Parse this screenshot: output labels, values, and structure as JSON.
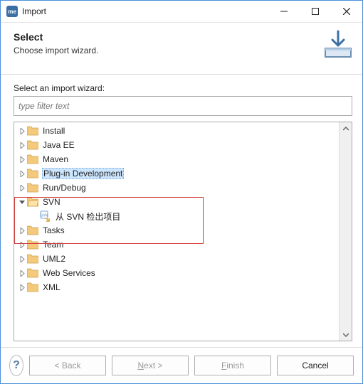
{
  "titlebar": {
    "app_short": "me",
    "title": "Import"
  },
  "header": {
    "heading": "Select",
    "subtext": "Choose import wizard."
  },
  "body": {
    "select_label": "Select an import wizard:",
    "filter_placeholder": "type filter text"
  },
  "tree": {
    "nodes": [
      {
        "label": "Install",
        "depth": 0,
        "expanded": false,
        "icon": "folder",
        "selected": false
      },
      {
        "label": "Java EE",
        "depth": 0,
        "expanded": false,
        "icon": "folder",
        "selected": false
      },
      {
        "label": "Maven",
        "depth": 0,
        "expanded": false,
        "icon": "folder",
        "selected": false
      },
      {
        "label": "Plug-in Development",
        "depth": 0,
        "expanded": false,
        "icon": "folder",
        "selected": false,
        "highlight": true
      },
      {
        "label": "Run/Debug",
        "depth": 0,
        "expanded": false,
        "icon": "folder",
        "selected": false
      },
      {
        "label": "SVN",
        "depth": 0,
        "expanded": true,
        "icon": "folder-open",
        "selected": false
      },
      {
        "label": "从 SVN 检出项目",
        "depth": 1,
        "expanded": null,
        "icon": "svn-checkout",
        "selected": false
      },
      {
        "label": "Tasks",
        "depth": 0,
        "expanded": false,
        "icon": "folder",
        "selected": false
      },
      {
        "label": "Team",
        "depth": 0,
        "expanded": false,
        "icon": "folder",
        "selected": false
      },
      {
        "label": "UML2",
        "depth": 0,
        "expanded": false,
        "icon": "folder",
        "selected": false
      },
      {
        "label": "Web Services",
        "depth": 0,
        "expanded": false,
        "icon": "folder",
        "selected": false
      },
      {
        "label": "XML",
        "depth": 0,
        "expanded": false,
        "icon": "folder",
        "selected": false
      }
    ]
  },
  "footer": {
    "back": "< Back",
    "next_prefix": "N",
    "next_rest": "ext >",
    "finish_prefix": "F",
    "finish_rest": "inish",
    "cancel": "Cancel"
  },
  "annotation": {
    "highlight_box": true
  }
}
